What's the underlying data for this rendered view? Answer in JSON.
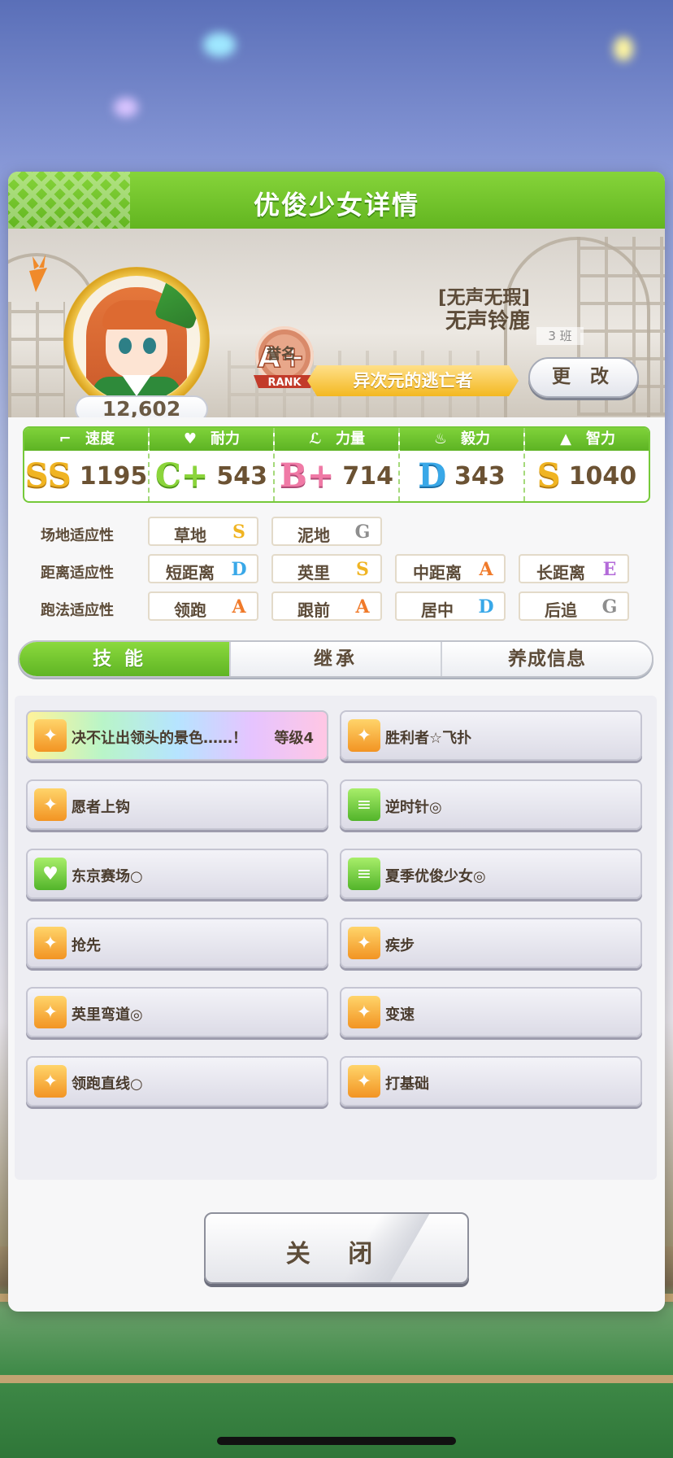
{
  "modal": {
    "title": "优俊少女详情"
  },
  "profile": {
    "score": "12,602",
    "rank_grade": "A+",
    "rank_word": "RANK",
    "rank_label": "誉名",
    "title_bracket": "[无声无瑕]",
    "name": "无声铃鹿",
    "class_tag": "3 班",
    "epithet": "异次元的逃亡者",
    "change_button": "更 改"
  },
  "stats": [
    {
      "label": "速度",
      "icon": "shoe-icon",
      "grade": "SS",
      "value": "1195"
    },
    {
      "label": "耐力",
      "icon": "heart-icon",
      "grade": "C+",
      "value": "543"
    },
    {
      "label": "力量",
      "icon": "muscle-icon",
      "grade": "B+",
      "value": "714"
    },
    {
      "label": "毅力",
      "icon": "flame-icon",
      "grade": "D",
      "value": "343"
    },
    {
      "label": "智力",
      "icon": "graduation-cap-icon",
      "grade": "S",
      "value": "1040"
    }
  ],
  "aptitude": {
    "surface_label": "场地适应性",
    "distance_label": "距离适应性",
    "strategy_label": "跑法适应性",
    "surface": [
      {
        "name": "草地",
        "grade": "S"
      },
      {
        "name": "泥地",
        "grade": "G"
      }
    ],
    "distance": [
      {
        "name": "短距离",
        "grade": "D"
      },
      {
        "name": "英里",
        "grade": "S"
      },
      {
        "name": "中距离",
        "grade": "A"
      },
      {
        "name": "长距离",
        "grade": "E"
      }
    ],
    "strategy": [
      {
        "name": "领跑",
        "grade": "A"
      },
      {
        "name": "跟前",
        "grade": "A"
      },
      {
        "name": "居中",
        "grade": "D"
      },
      {
        "name": "后追",
        "grade": "G"
      }
    ]
  },
  "tabs": [
    {
      "label": "技能",
      "active": true
    },
    {
      "label": "继承",
      "active": false
    },
    {
      "label": "养成信息",
      "active": false
    }
  ],
  "skills": [
    {
      "name": "决不让出领头的景色……！",
      "level": "等级4",
      "icon": "unique-skill-icon"
    },
    {
      "name": "胜利者☆飞扑",
      "icon": "speed-skill-icon"
    },
    {
      "name": "愿者上钩",
      "icon": "speed-skill-icon"
    },
    {
      "name": "逆时针◎",
      "icon": "passive-skill-icon"
    },
    {
      "name": "东京赛场○",
      "icon": "recovery-skill-icon"
    },
    {
      "name": "夏季优俊少女◎",
      "icon": "passive-skill-icon"
    },
    {
      "name": "抢先",
      "icon": "speed-skill-icon"
    },
    {
      "name": "疾步",
      "icon": "speed-skill-icon"
    },
    {
      "name": "英里弯道◎",
      "icon": "speed-skill-icon"
    },
    {
      "name": "变速",
      "icon": "speed-skill-icon"
    },
    {
      "name": "领跑直线○",
      "icon": "speed-skill-icon"
    },
    {
      "name": "打基础",
      "icon": "speed-skill-icon"
    }
  ],
  "close_button": "关 闭"
}
